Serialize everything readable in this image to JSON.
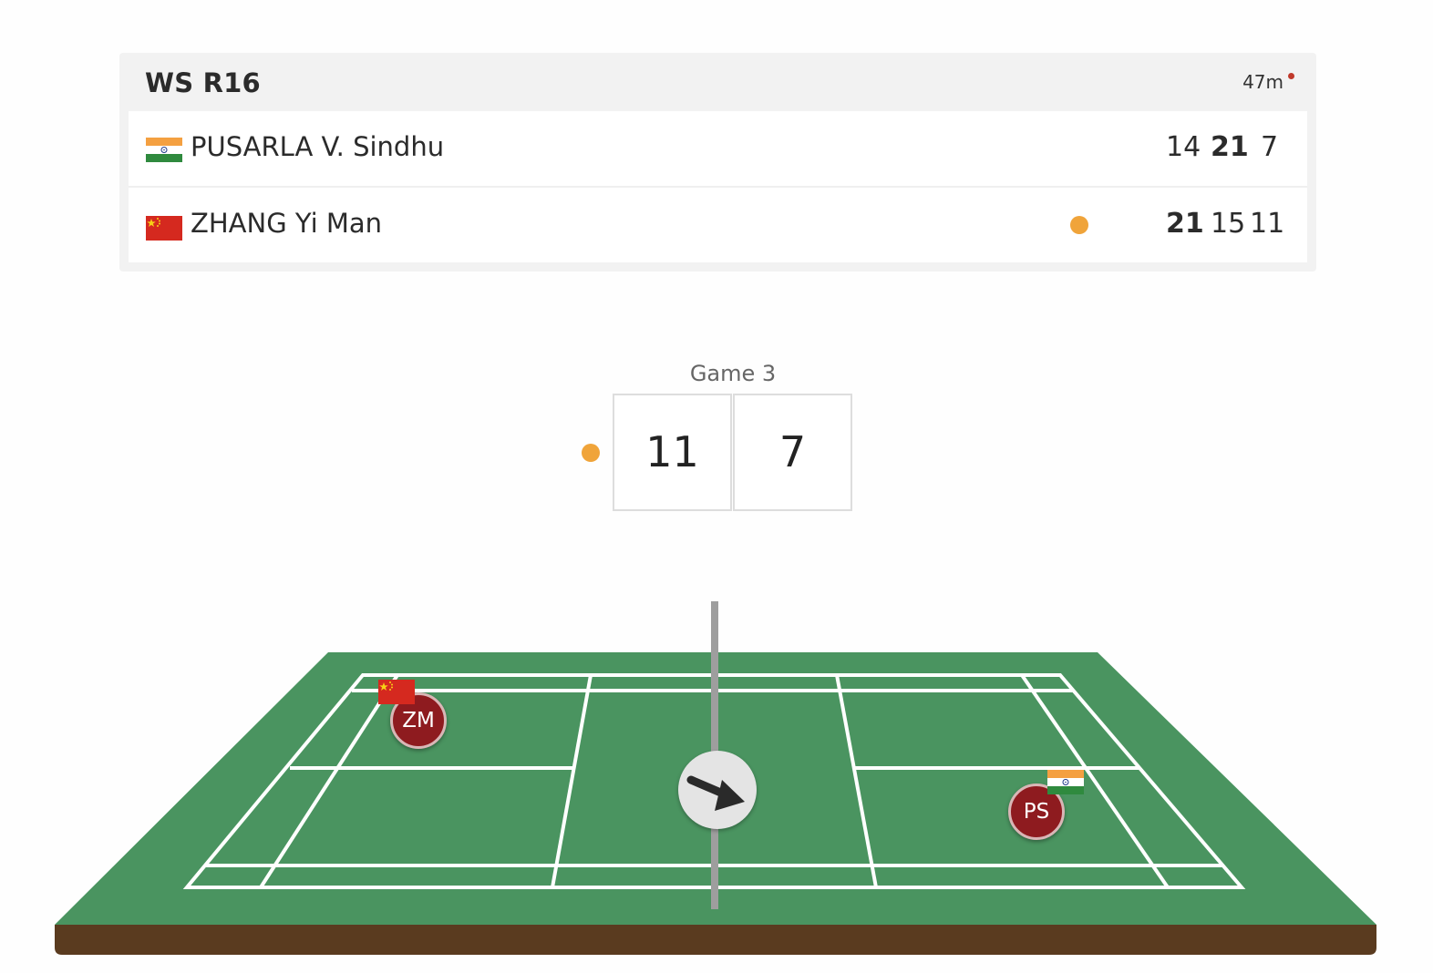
{
  "match": {
    "event": "WS R16",
    "duration": "47m",
    "players": [
      {
        "name": "PUSARLA V. Sindhu",
        "country": "India",
        "flag_icon": "india-flag-icon",
        "serving": false,
        "scores": [
          "14",
          "21",
          "7"
        ],
        "game_won": [
          false,
          true,
          false
        ]
      },
      {
        "name": "ZHANG Yi Man",
        "country": "China",
        "flag_icon": "china-flag-icon",
        "serving": true,
        "scores": [
          "21",
          "15",
          "11"
        ],
        "game_won": [
          true,
          false,
          false
        ]
      }
    ]
  },
  "current_game": {
    "label": "Game 3",
    "left_score": "11",
    "right_score": "7",
    "serving_side": "left"
  },
  "court": {
    "left_player": {
      "initials": "ZM",
      "flag_icon": "china-flag-icon"
    },
    "right_player": {
      "initials": "PS",
      "flag_icon": "india-flag-icon"
    },
    "shuttle_icon": "arrow-down-right-icon"
  },
  "colors": {
    "court_green": "#4a9460",
    "court_base": "#5a3b1f",
    "serve_dot": "#f0a43a",
    "player_marker": "#8e1b1f",
    "live_dot": "#c0392b"
  }
}
